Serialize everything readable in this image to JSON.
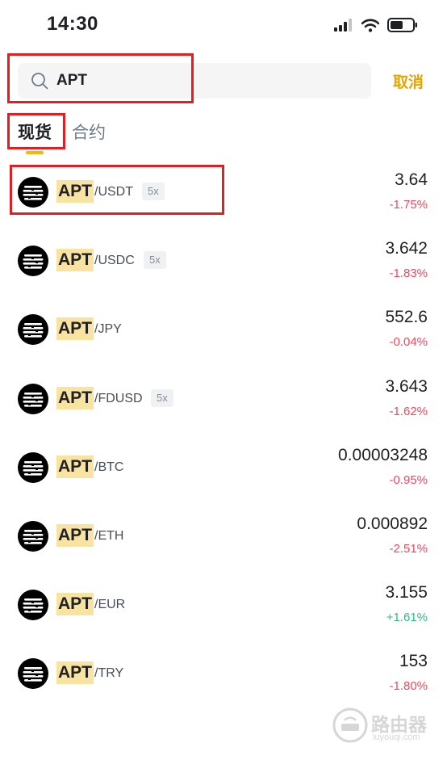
{
  "status_bar": {
    "time": "14:30"
  },
  "search": {
    "value": "APT",
    "cancel_label": "取消"
  },
  "tabs": [
    {
      "label": "现货",
      "active": true
    },
    {
      "label": "合约",
      "active": false
    }
  ],
  "colors": {
    "accent": "#f0b90b",
    "cancel": "#e6a400",
    "negative": "#f6465d",
    "positive": "#2ebd85",
    "highlight": "#f9e3a1",
    "annotation": "#e02020"
  },
  "pairs": [
    {
      "base": "APT",
      "quote": "/USDT",
      "leverage": "5x",
      "price": "3.64",
      "change": "-1.75%",
      "direction": "neg",
      "icon": "aptos-logo-icon"
    },
    {
      "base": "APT",
      "quote": "/USDC",
      "leverage": "5x",
      "price": "3.642",
      "change": "-1.83%",
      "direction": "neg",
      "icon": "aptos-logo-icon"
    },
    {
      "base": "APT",
      "quote": "/JPY",
      "leverage": "",
      "price": "552.6",
      "change": "-0.04%",
      "direction": "neg",
      "icon": "aptos-logo-icon"
    },
    {
      "base": "APT",
      "quote": "/FDUSD",
      "leverage": "5x",
      "price": "3.643",
      "change": "-1.62%",
      "direction": "neg",
      "icon": "aptos-logo-icon"
    },
    {
      "base": "APT",
      "quote": "/BTC",
      "leverage": "",
      "price": "0.00003248",
      "change": "-0.95%",
      "direction": "neg",
      "icon": "aptos-logo-icon"
    },
    {
      "base": "APT",
      "quote": "/ETH",
      "leverage": "",
      "price": "0.000892",
      "change": "-2.51%",
      "direction": "neg",
      "icon": "aptos-logo-icon"
    },
    {
      "base": "APT",
      "quote": "/EUR",
      "leverage": "",
      "price": "3.155",
      "change": "+1.61%",
      "direction": "pos",
      "icon": "aptos-logo-icon"
    },
    {
      "base": "APT",
      "quote": "/TRY",
      "leverage": "",
      "price": "153",
      "change": "-1.80%",
      "direction": "neg",
      "icon": "aptos-logo-icon"
    }
  ],
  "watermark": {
    "text": "路由器",
    "sub": "luyouqi.com"
  }
}
